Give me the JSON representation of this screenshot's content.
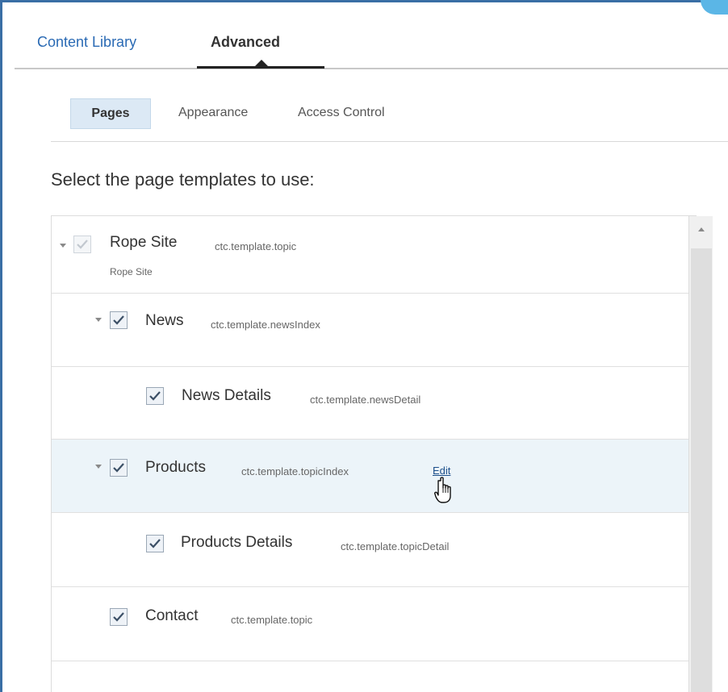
{
  "tabs": {
    "content_library": "Content Library",
    "advanced": "Advanced"
  },
  "subtabs": {
    "pages": "Pages",
    "appearance": "Appearance",
    "access_control": "Access Control"
  },
  "heading": "Select the page templates to use:",
  "tree": [
    {
      "name": "Rope Site",
      "template": "ctc.template.topic",
      "subtitle": "Rope Site",
      "checked": true,
      "disabled": true,
      "expanded": true
    },
    {
      "name": "News",
      "template": "ctc.template.newsIndex",
      "checked": true,
      "expanded": true
    },
    {
      "name": "News Details",
      "template": "ctc.template.newsDetail",
      "checked": true
    },
    {
      "name": "Products",
      "template": "ctc.template.topicIndex",
      "checked": true,
      "expanded": true,
      "action": "Edit",
      "highlighted": true
    },
    {
      "name": "Products Details",
      "template": "ctc.template.topicDetail",
      "checked": true
    },
    {
      "name": "Contact",
      "template": "ctc.template.topic",
      "checked": true
    }
  ],
  "icons": {
    "checkbox_check": "check-icon",
    "expand": "caret-down-icon",
    "scroll_up": "chevron-up-icon",
    "pointer": "hand-pointer-icon"
  },
  "colors": {
    "frame": "#3a6ea5",
    "link": "#2a6ab4",
    "selected_tab_bg": "#dce9f5",
    "row_highlight": "#ecf4f9"
  }
}
